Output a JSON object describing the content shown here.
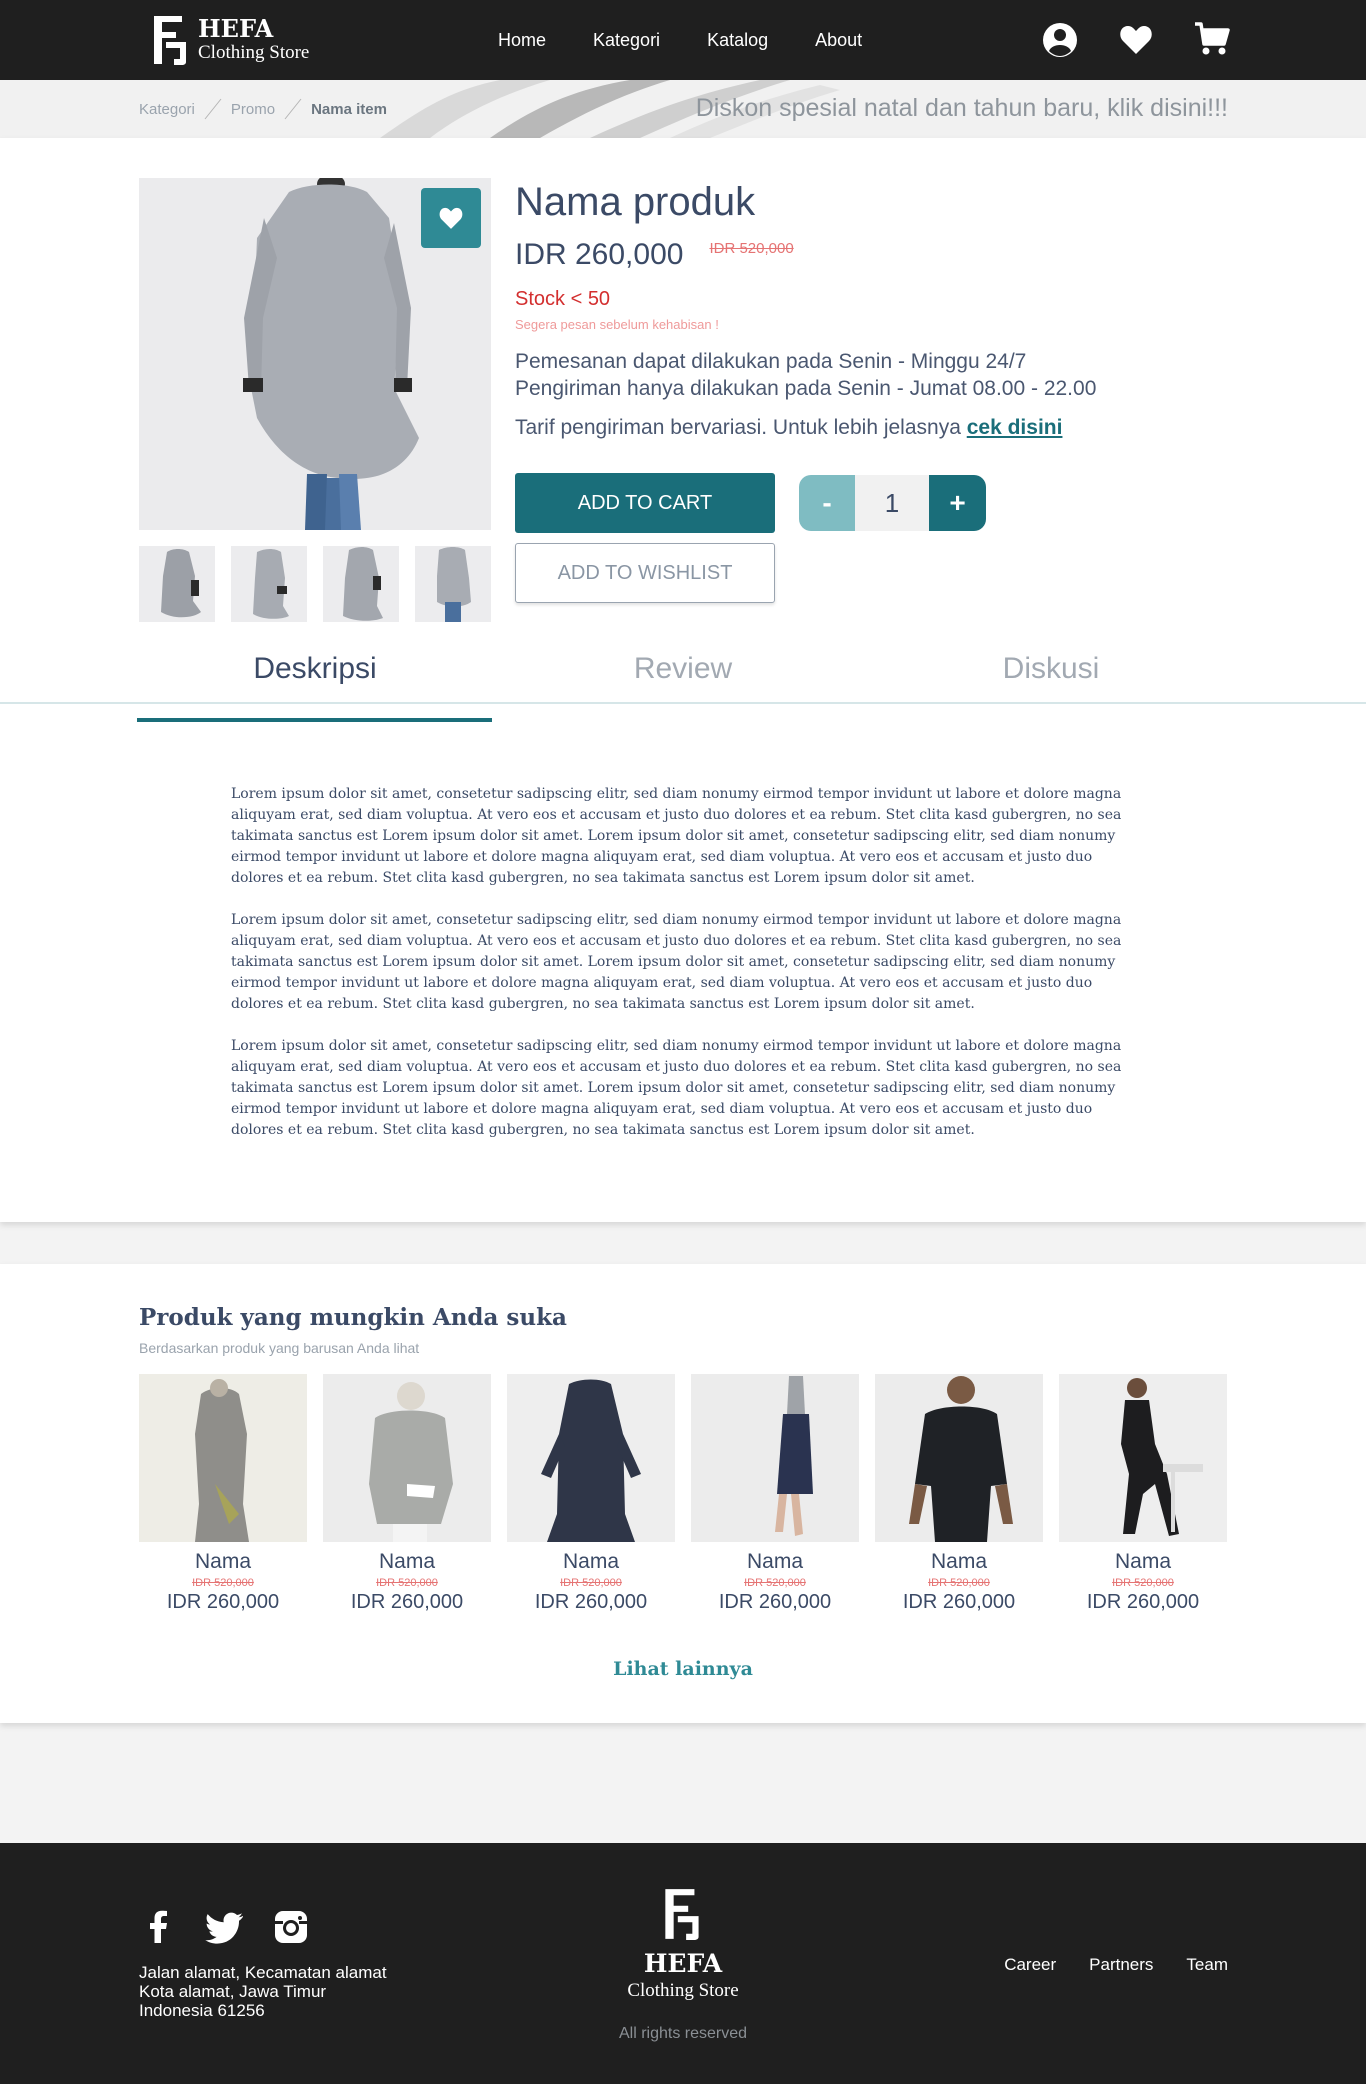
{
  "brand": {
    "name": "HEFA",
    "tagline": "Clothing Store"
  },
  "nav": {
    "items": [
      "Home",
      "Kategori",
      "Katalog",
      "About"
    ],
    "icons": [
      "account-icon",
      "heart-icon",
      "cart-icon"
    ]
  },
  "breadcrumb": {
    "items": [
      "Kategori",
      "Promo"
    ],
    "current": "Nama item"
  },
  "promo_text": "Diskon spesial natal dan tahun baru, klik disini!!!",
  "product": {
    "name": "Nama produk",
    "price": "IDR 260,000",
    "old_price": "IDR 520,000",
    "stock": "Stock < 50",
    "stock_note": "Segera pesan sebelum kehabisan !",
    "order_line1": "Pemesanan dapat dilakukan pada Senin - Minggu 24/7",
    "order_line2": "Pengiriman hanya dilakukan pada Senin - Jumat 08.00 - 22.00",
    "shipping_text": "Tarif pengiriman bervariasi. Untuk lebih jelasnya",
    "shipping_link": "cek disini",
    "add_to_cart": "ADD TO CART",
    "add_to_wishlist": "ADD TO WISHLIST",
    "qty_minus": "-",
    "qty_value": "1",
    "qty_plus": "+"
  },
  "tabs": [
    "Deskripsi",
    "Review",
    "Diskusi"
  ],
  "description": [
    "Lorem ipsum dolor sit amet, consetetur sadipscing elitr, sed diam nonumy eirmod tempor invidunt ut labore et dolore magna aliquyam erat, sed diam voluptua. At vero eos et accusam et justo duo dolores et ea rebum. Stet clita kasd gubergren, no sea takimata sanctus est Lorem ipsum dolor sit amet. Lorem ipsum dolor sit amet, consetetur sadipscing elitr, sed diam nonumy eirmod tempor invidunt ut labore et dolore magna aliquyam erat, sed diam voluptua. At vero eos et accusam et justo duo dolores et ea rebum. Stet clita kasd gubergren, no sea takimata sanctus est Lorem ipsum dolor sit amet.",
    "Lorem ipsum dolor sit amet, consetetur sadipscing elitr, sed diam nonumy eirmod tempor invidunt ut labore et dolore magna aliquyam erat, sed diam voluptua. At vero eos et accusam et justo duo dolores et ea rebum. Stet clita kasd gubergren, no sea takimata sanctus est Lorem ipsum dolor sit amet. Lorem ipsum dolor sit amet, consetetur sadipscing elitr, sed diam nonumy eirmod tempor invidunt ut labore et dolore magna aliquyam erat, sed diam voluptua. At vero eos et accusam et justo duo dolores et ea rebum. Stet clita kasd gubergren, no sea takimata sanctus est Lorem ipsum dolor sit amet.",
    "Lorem ipsum dolor sit amet, consetetur sadipscing elitr, sed diam nonumy eirmod tempor invidunt ut labore et dolore magna aliquyam erat, sed diam voluptua. At vero eos et accusam et justo duo dolores et ea rebum. Stet clita kasd gubergren, no sea takimata sanctus est Lorem ipsum dolor sit amet. Lorem ipsum dolor sit amet, consetetur sadipscing elitr, sed diam nonumy eirmod tempor invidunt ut labore et dolore magna aliquyam erat, sed diam voluptua. At vero eos et accusam et justo duo dolores et ea rebum. Stet clita kasd gubergren, no sea takimata sanctus est Lorem ipsum dolor sit amet."
  ],
  "recommendations": {
    "title": "Produk yang mungkin Anda suka",
    "subtitle": "Berdasarkan produk yang barusan Anda lihat",
    "items": [
      {
        "name": "Nama",
        "old_price": "IDR 520,000",
        "price": "IDR 260,000"
      },
      {
        "name": "Nama",
        "old_price": "IDR 520,000",
        "price": "IDR 260,000"
      },
      {
        "name": "Nama",
        "old_price": "IDR 520,000",
        "price": "IDR 260,000"
      },
      {
        "name": "Nama",
        "old_price": "IDR 520,000",
        "price": "IDR 260,000"
      },
      {
        "name": "Nama",
        "old_price": "IDR 520,000",
        "price": "IDR 260,000"
      },
      {
        "name": "Nama",
        "old_price": "IDR 520,000",
        "price": "IDR 260,000"
      }
    ],
    "more": "Lihat lainnya"
  },
  "footer": {
    "address": [
      "Jalan alamat, Kecamatan alamat",
      "Kota alamat, Jawa Timur",
      "Indonesia 61256"
    ],
    "rights": "All rights reserved",
    "links": [
      "Career",
      "Partners",
      "Team"
    ],
    "social": [
      "facebook-icon",
      "twitter-icon",
      "instagram-icon"
    ]
  },
  "colors": {
    "nav_bg": "#1f1f1f",
    "accent": "#1a6e7a",
    "accent_light": "#7fbcc2",
    "sale": "#d32f2f"
  }
}
